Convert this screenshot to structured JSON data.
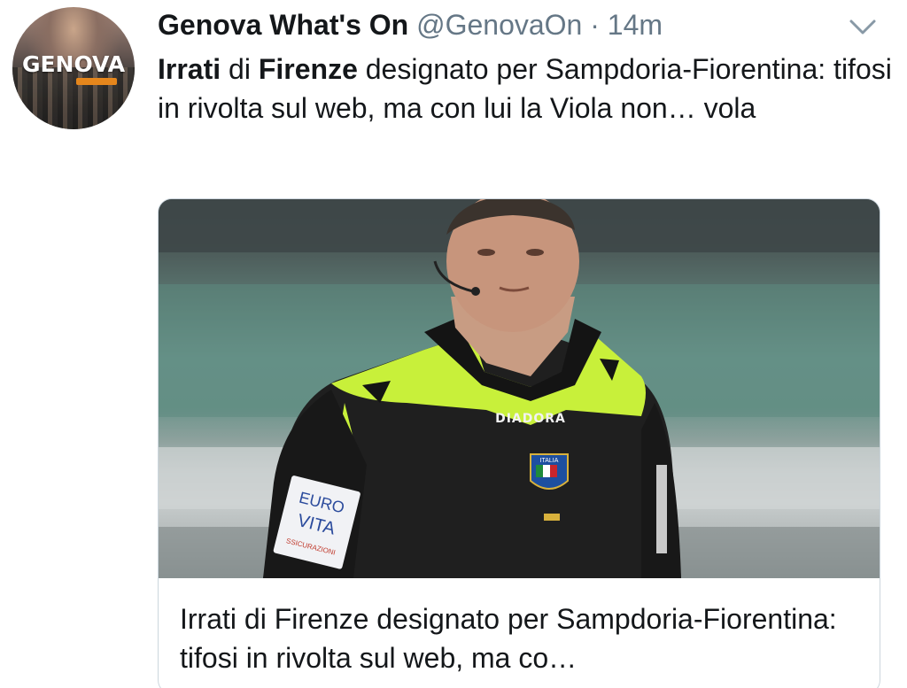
{
  "author": {
    "display_name": "Genova What's On",
    "handle": "@GenovaOn",
    "separator": "·",
    "time": "14m",
    "avatar_text": "GENOVA"
  },
  "tweet": {
    "part1_bold": "Irrati",
    "part2": " di ",
    "part3_bold": "Firenze",
    "part4": " designato per Sampdoria-Fiorentina: tifosi in rivolta sul web, ma con lui la Viola non… vola"
  },
  "card": {
    "title": "Irrati di Firenze designato per Sampdoria-Fiorentina: tifosi in rivolta sul web, ma co…",
    "image": {
      "shirt_brand": "DIADORA",
      "sleeve_patch_line1": "EURO",
      "sleeve_patch_line2": "VITA",
      "sleeve_patch_line3": "SSICURAZIONI",
      "badge_text": "ITALIA"
    }
  },
  "icons": {
    "chevron": "chevron-down-icon"
  },
  "colors": {
    "text": "#14171a",
    "secondary": "#657786",
    "card_border": "#ccd6dd",
    "jersey_yellow": "#c8f03a",
    "jersey_black": "#1c1c1c"
  }
}
